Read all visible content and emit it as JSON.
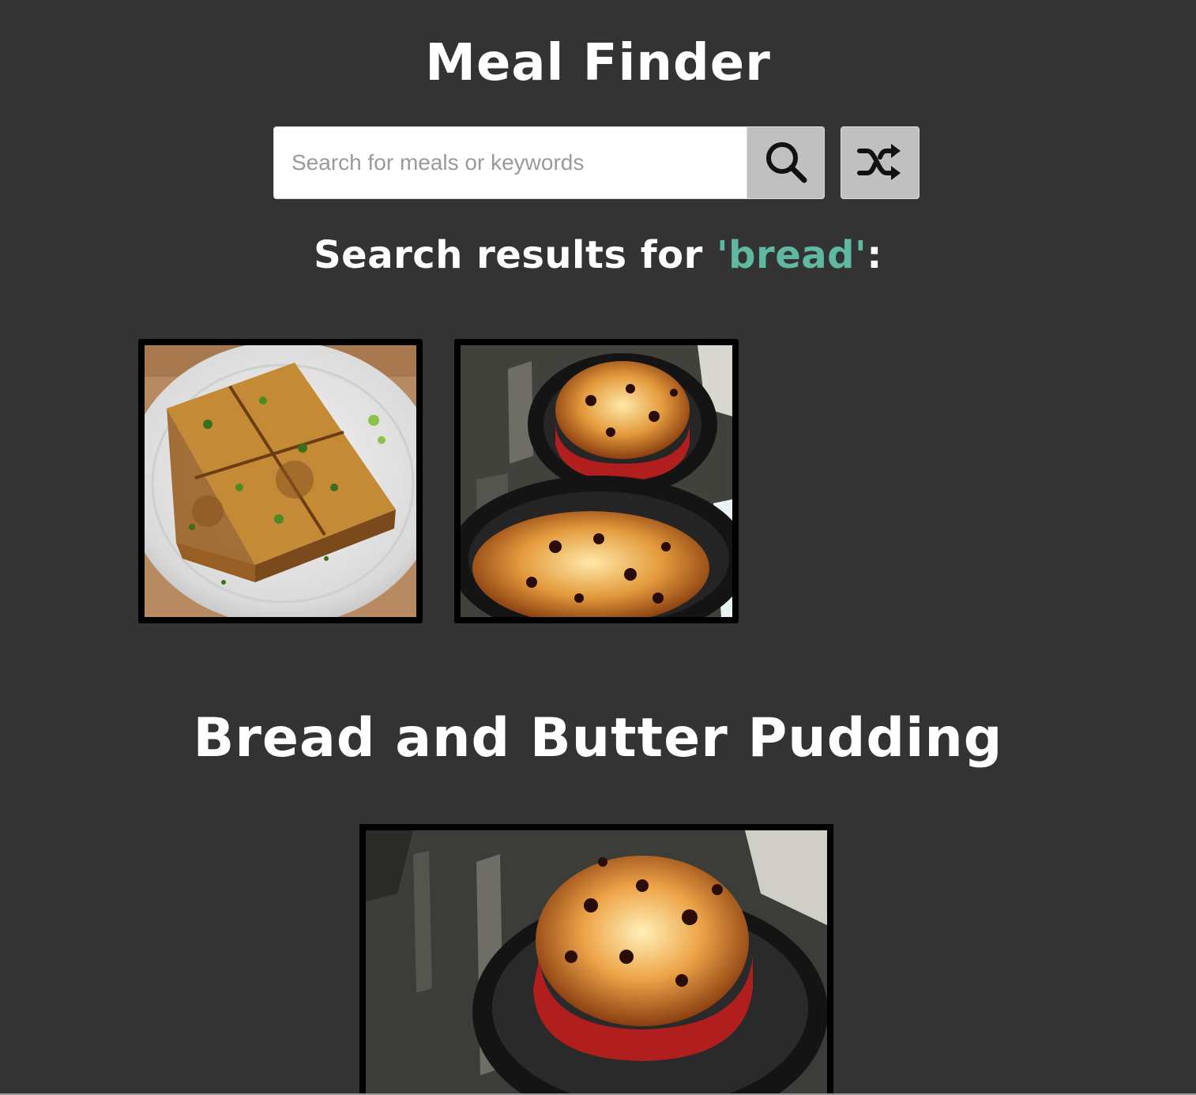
{
  "header": {
    "title": "Meal Finder"
  },
  "search": {
    "placeholder": "Search for meals or keywords",
    "value": "",
    "search_icon": "search-icon",
    "random_icon": "shuffle-icon"
  },
  "results": {
    "prefix": "Search results for ",
    "query": "'bread'",
    "suffix": ":",
    "query_color": "#5fb8a0",
    "meals": [
      {
        "image": "meal-photo-bread-omelette"
      },
      {
        "image": "meal-photo-bread-and-butter-pudding"
      }
    ]
  },
  "selected_meal": {
    "title": "Bread and Butter Pudding",
    "image": "meal-photo-bread-and-butter-pudding"
  },
  "colors": {
    "background": "#333333",
    "accent": "#5fb8a0",
    "button": "#c0c0c0"
  }
}
